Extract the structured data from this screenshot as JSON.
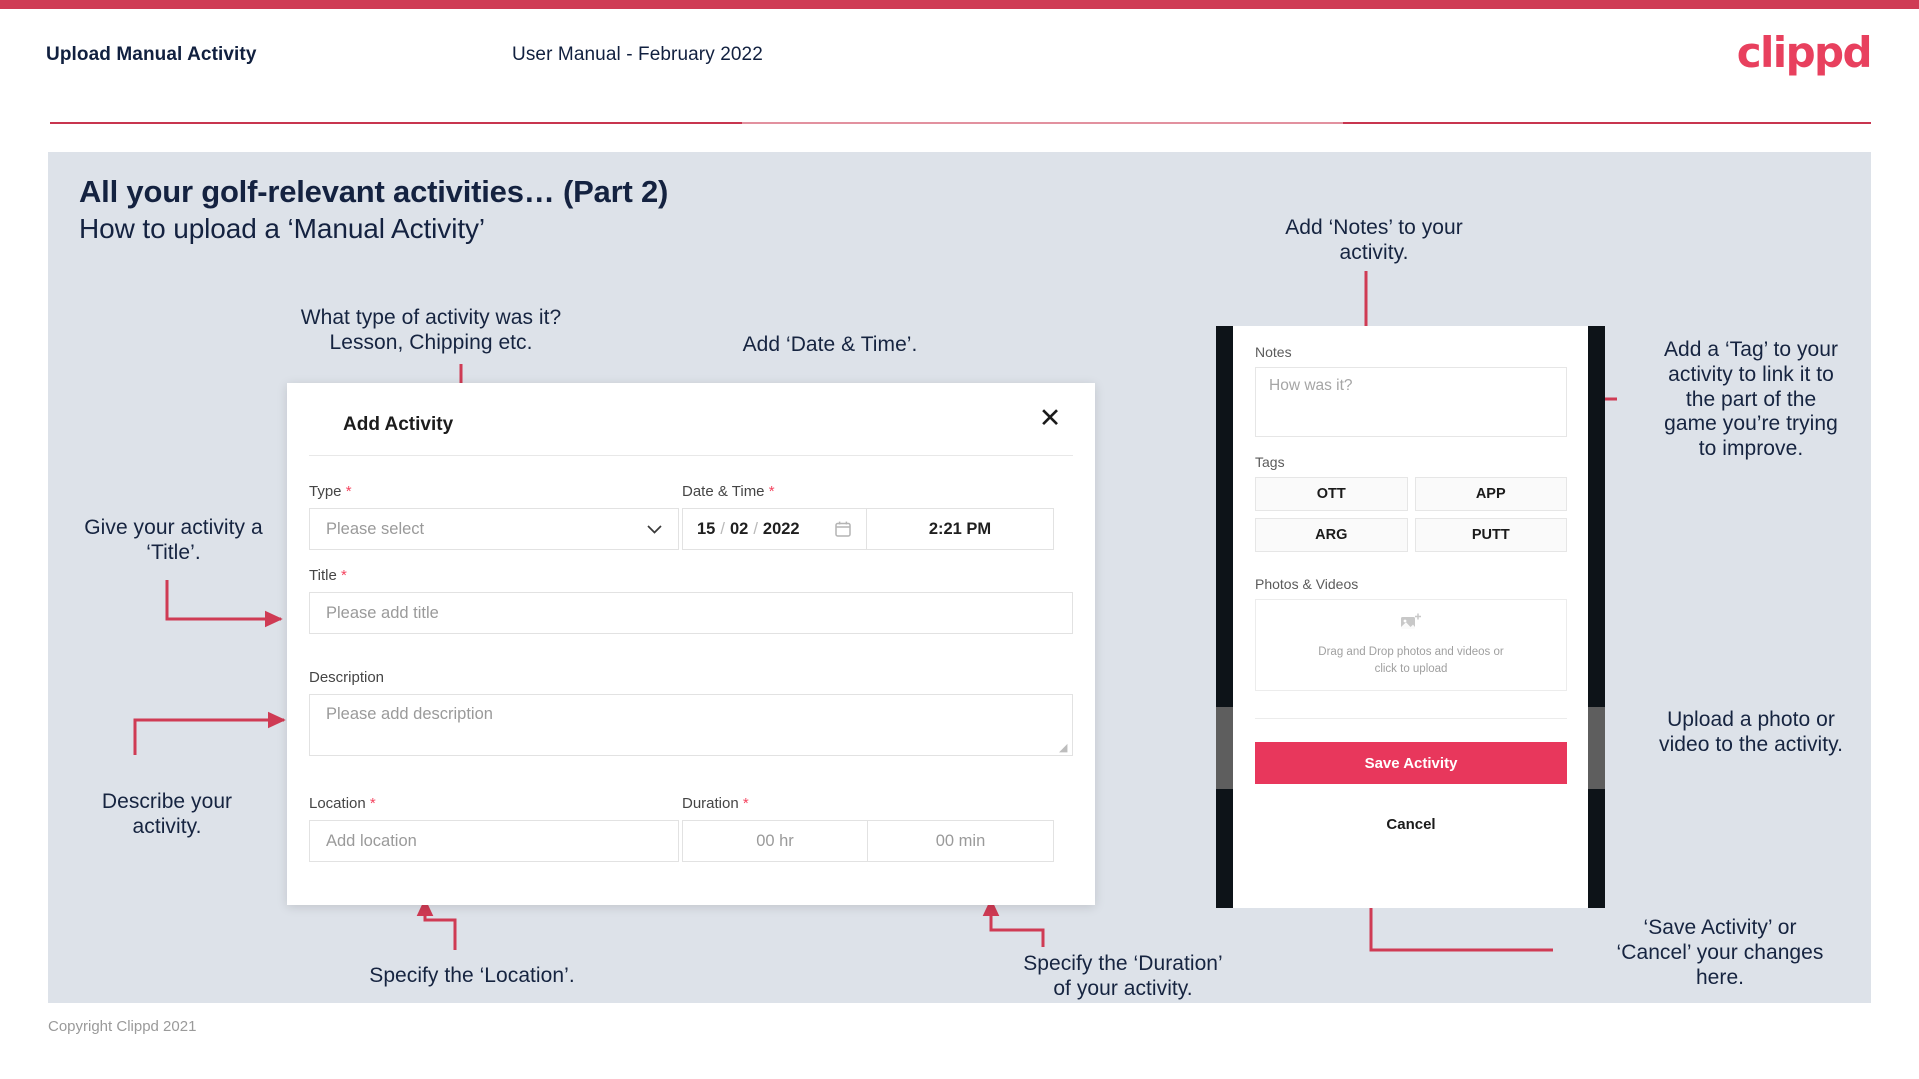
{
  "header": {
    "left_title": "Upload Manual Activity",
    "center_title": "User Manual - February 2022",
    "logo": "clippd"
  },
  "slide": {
    "title": "All your golf-relevant activities… (Part 2)",
    "subtitle": "How to upload a ‘Manual Activity’"
  },
  "annotations": {
    "type": "What type of activity was it?\nLesson, Chipping etc.",
    "datetime": "Add ‘Date & Time’.",
    "title": "Give your activity a\n‘Title’.",
    "describe": "Describe your\nactivity.",
    "location": "Specify the ‘Location’.",
    "duration": "Specify the ‘Duration’\nof your activity.",
    "notes": "Add ‘Notes’ to your\nactivity.",
    "tags": "Add a ‘Tag’ to your\nactivity to link it to\nthe part of the\ngame you’re trying\nto improve.",
    "upload": "Upload a photo or\nvideo to the activity.",
    "save": "‘Save Activity’ or\n‘Cancel’ your changes\nhere."
  },
  "dialog": {
    "title": "Add Activity",
    "close_icon": "close-icon",
    "fields": {
      "type": {
        "label": "Type",
        "required": "*",
        "placeholder": "Please select",
        "chevron": "chevron-down-icon"
      },
      "datetime": {
        "label": "Date & Time",
        "required": "*",
        "day": "15",
        "month": "02",
        "year": "2022",
        "sep": "/",
        "calendar_icon": "calendar-icon",
        "time": "2:21 PM"
      },
      "title": {
        "label": "Title",
        "required": "*",
        "placeholder": "Please add title"
      },
      "description": {
        "label": "Description",
        "required": "",
        "placeholder": "Please add description"
      },
      "location": {
        "label": "Location",
        "required": "*",
        "placeholder": "Add location"
      },
      "duration": {
        "label": "Duration",
        "required": "*",
        "hours_placeholder": "00 hr",
        "minutes_placeholder": "00 min"
      }
    }
  },
  "phone": {
    "notes": {
      "label": "Notes",
      "placeholder": "How was it?"
    },
    "tags": {
      "label": "Tags",
      "items": [
        "OTT",
        "APP",
        "ARG",
        "PUTT"
      ]
    },
    "photos": {
      "label": "Photos & Videos",
      "icon": "add-image-icon",
      "line1": "Drag and Drop photos and videos or",
      "line2": "click to upload"
    },
    "save_label": "Save Activity",
    "cancel_label": "Cancel"
  },
  "footer": {
    "copyright": "Copyright Clippd 2021"
  },
  "colors": {
    "accent": "#cf3b54",
    "brand_pink": "#e8405e",
    "save_button": "#e8375c",
    "slide_bg": "#dde2e9",
    "text_dark": "#142240",
    "required": "#f4445f"
  }
}
